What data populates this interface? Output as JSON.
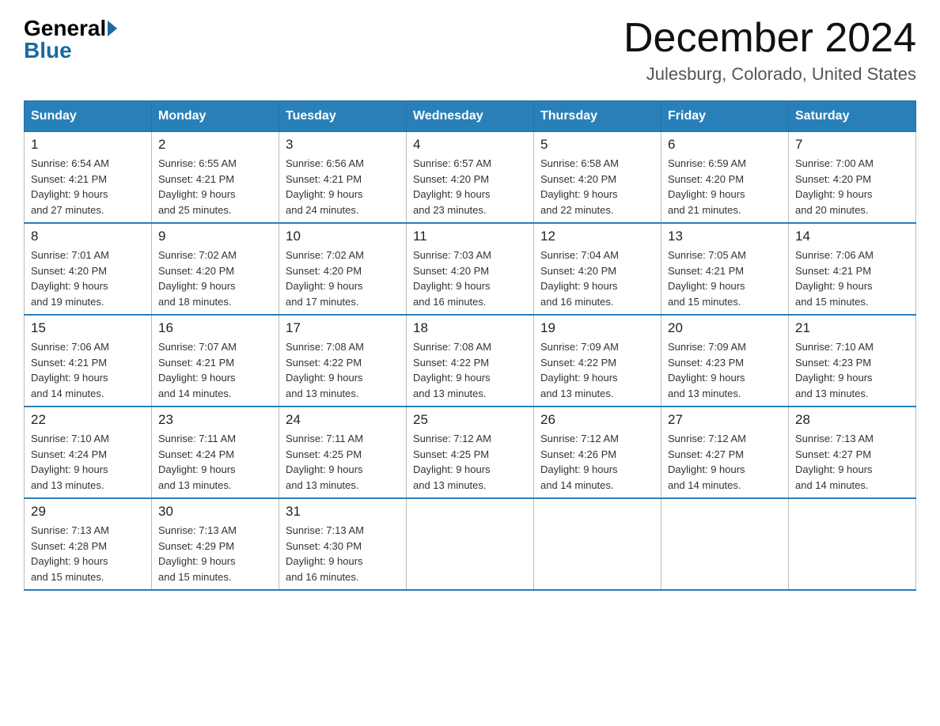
{
  "logo": {
    "general": "General",
    "blue": "Blue"
  },
  "title": "December 2024",
  "location": "Julesburg, Colorado, United States",
  "days_of_week": [
    "Sunday",
    "Monday",
    "Tuesday",
    "Wednesday",
    "Thursday",
    "Friday",
    "Saturday"
  ],
  "weeks": [
    [
      {
        "day": "1",
        "sunrise": "6:54 AM",
        "sunset": "4:21 PM",
        "daylight": "9 hours and 27 minutes."
      },
      {
        "day": "2",
        "sunrise": "6:55 AM",
        "sunset": "4:21 PM",
        "daylight": "9 hours and 25 minutes."
      },
      {
        "day": "3",
        "sunrise": "6:56 AM",
        "sunset": "4:21 PM",
        "daylight": "9 hours and 24 minutes."
      },
      {
        "day": "4",
        "sunrise": "6:57 AM",
        "sunset": "4:20 PM",
        "daylight": "9 hours and 23 minutes."
      },
      {
        "day": "5",
        "sunrise": "6:58 AM",
        "sunset": "4:20 PM",
        "daylight": "9 hours and 22 minutes."
      },
      {
        "day": "6",
        "sunrise": "6:59 AM",
        "sunset": "4:20 PM",
        "daylight": "9 hours and 21 minutes."
      },
      {
        "day": "7",
        "sunrise": "7:00 AM",
        "sunset": "4:20 PM",
        "daylight": "9 hours and 20 minutes."
      }
    ],
    [
      {
        "day": "8",
        "sunrise": "7:01 AM",
        "sunset": "4:20 PM",
        "daylight": "9 hours and 19 minutes."
      },
      {
        "day": "9",
        "sunrise": "7:02 AM",
        "sunset": "4:20 PM",
        "daylight": "9 hours and 18 minutes."
      },
      {
        "day": "10",
        "sunrise": "7:02 AM",
        "sunset": "4:20 PM",
        "daylight": "9 hours and 17 minutes."
      },
      {
        "day": "11",
        "sunrise": "7:03 AM",
        "sunset": "4:20 PM",
        "daylight": "9 hours and 16 minutes."
      },
      {
        "day": "12",
        "sunrise": "7:04 AM",
        "sunset": "4:20 PM",
        "daylight": "9 hours and 16 minutes."
      },
      {
        "day": "13",
        "sunrise": "7:05 AM",
        "sunset": "4:21 PM",
        "daylight": "9 hours and 15 minutes."
      },
      {
        "day": "14",
        "sunrise": "7:06 AM",
        "sunset": "4:21 PM",
        "daylight": "9 hours and 15 minutes."
      }
    ],
    [
      {
        "day": "15",
        "sunrise": "7:06 AM",
        "sunset": "4:21 PM",
        "daylight": "9 hours and 14 minutes."
      },
      {
        "day": "16",
        "sunrise": "7:07 AM",
        "sunset": "4:21 PM",
        "daylight": "9 hours and 14 minutes."
      },
      {
        "day": "17",
        "sunrise": "7:08 AM",
        "sunset": "4:22 PM",
        "daylight": "9 hours and 13 minutes."
      },
      {
        "day": "18",
        "sunrise": "7:08 AM",
        "sunset": "4:22 PM",
        "daylight": "9 hours and 13 minutes."
      },
      {
        "day": "19",
        "sunrise": "7:09 AM",
        "sunset": "4:22 PM",
        "daylight": "9 hours and 13 minutes."
      },
      {
        "day": "20",
        "sunrise": "7:09 AM",
        "sunset": "4:23 PM",
        "daylight": "9 hours and 13 minutes."
      },
      {
        "day": "21",
        "sunrise": "7:10 AM",
        "sunset": "4:23 PM",
        "daylight": "9 hours and 13 minutes."
      }
    ],
    [
      {
        "day": "22",
        "sunrise": "7:10 AM",
        "sunset": "4:24 PM",
        "daylight": "9 hours and 13 minutes."
      },
      {
        "day": "23",
        "sunrise": "7:11 AM",
        "sunset": "4:24 PM",
        "daylight": "9 hours and 13 minutes."
      },
      {
        "day": "24",
        "sunrise": "7:11 AM",
        "sunset": "4:25 PM",
        "daylight": "9 hours and 13 minutes."
      },
      {
        "day": "25",
        "sunrise": "7:12 AM",
        "sunset": "4:25 PM",
        "daylight": "9 hours and 13 minutes."
      },
      {
        "day": "26",
        "sunrise": "7:12 AM",
        "sunset": "4:26 PM",
        "daylight": "9 hours and 14 minutes."
      },
      {
        "day": "27",
        "sunrise": "7:12 AM",
        "sunset": "4:27 PM",
        "daylight": "9 hours and 14 minutes."
      },
      {
        "day": "28",
        "sunrise": "7:13 AM",
        "sunset": "4:27 PM",
        "daylight": "9 hours and 14 minutes."
      }
    ],
    [
      {
        "day": "29",
        "sunrise": "7:13 AM",
        "sunset": "4:28 PM",
        "daylight": "9 hours and 15 minutes."
      },
      {
        "day": "30",
        "sunrise": "7:13 AM",
        "sunset": "4:29 PM",
        "daylight": "9 hours and 15 minutes."
      },
      {
        "day": "31",
        "sunrise": "7:13 AM",
        "sunset": "4:30 PM",
        "daylight": "9 hours and 16 minutes."
      },
      null,
      null,
      null,
      null
    ]
  ],
  "labels": {
    "sunrise": "Sunrise:",
    "sunset": "Sunset:",
    "daylight": "Daylight:"
  }
}
